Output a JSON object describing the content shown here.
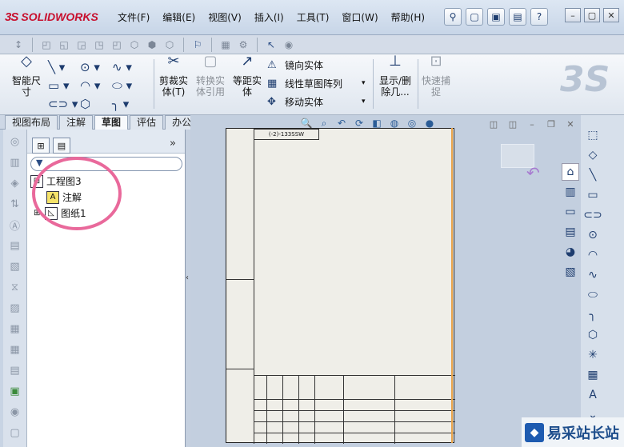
{
  "app": {
    "brand": "SOLIDWORKS",
    "brand_prefix": "3S"
  },
  "menu": [
    "文件(F)",
    "编辑(E)",
    "视图(V)",
    "插入(I)",
    "工具(T)",
    "窗口(W)",
    "帮助(H)"
  ],
  "ribbon": {
    "smart_dim": "智能尺寸",
    "trim": "剪裁实体(T)",
    "convert": "转换实体引用",
    "offset": "等距实体",
    "mirror": "镜向实体",
    "linear_pattern": "线性草图阵列",
    "move": "移动实体",
    "show_delete": "显示/删除几...",
    "quick_snap": "快速捕捉"
  },
  "tabs": [
    "视图布局",
    "注解",
    "草图",
    "评估",
    "办公室产品"
  ],
  "active_tab": "草图",
  "tree": {
    "root": "工程图3",
    "annotations": "注解",
    "sheet": "图纸1"
  },
  "sheet": {
    "label": "(-2)-133SSW"
  },
  "watermark": {
    "text": "易采站长站"
  },
  "colors": {
    "highlight_circle": "#e9699b",
    "brand_red": "#c8102e"
  }
}
